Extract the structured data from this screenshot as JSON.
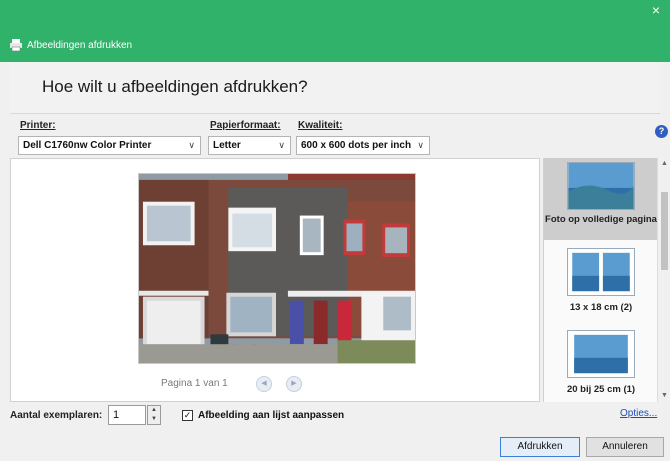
{
  "window": {
    "title": "Afbeeldingen afdrukken",
    "close_glyph": "×",
    "colors": {
      "titlebar": "#31b26a",
      "link": "#1c4fb4"
    }
  },
  "header": {
    "question": "Hoe wilt u afbeeldingen afdrukken?"
  },
  "options": {
    "printer_label": "Printer:",
    "printer_value": "Dell C1760nw Color Printer",
    "paper_label": "Papierformaat:",
    "paper_value": "Letter",
    "quality_label": "Kwaliteit:",
    "quality_value": "600 x 600 dots per inch",
    "help_glyph": "?"
  },
  "preview": {
    "page_text": "Pagina 1 van 1",
    "prev_glyph": "◀",
    "next_glyph": "▶"
  },
  "layouts": [
    {
      "label": "Foto op volledige pagina",
      "selected": true
    },
    {
      "label": "13 x 18 cm (2)",
      "selected": false
    },
    {
      "label": "20 bij 25 cm (1)",
      "selected": false
    }
  ],
  "footer": {
    "copies_label": "Aantal exemplaren:",
    "copies_value": "1",
    "fit_label": "Afbeelding aan lijst aanpassen",
    "fit_checked": true,
    "options_link": "Opties...",
    "print_button": "Afdrukken",
    "cancel_button": "Annuleren"
  }
}
